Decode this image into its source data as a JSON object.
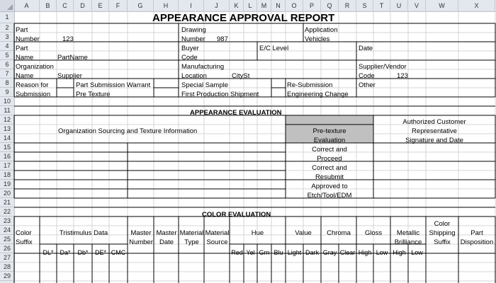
{
  "title": "APPEARANCE APPROVAL REPORT",
  "columns": [
    "A",
    "B",
    "C",
    "D",
    "E",
    "F",
    "G",
    "H",
    "I",
    "J",
    "K",
    "L",
    "M",
    "N",
    "O",
    "P",
    "Q",
    "R",
    "S",
    "T",
    "U",
    "V",
    "W",
    "X"
  ],
  "rows": [
    "1",
    "2",
    "3",
    "4",
    "5",
    "6",
    "7",
    "8",
    "9",
    "10",
    "11",
    "12",
    "13",
    "14",
    "15",
    "16",
    "17",
    "18",
    "19",
    "20",
    "21",
    "22",
    "23",
    "24",
    "25",
    "26",
    "27",
    "28",
    "29"
  ],
  "header": {
    "part_label": "Part",
    "part_number_label": "Number",
    "part_number": "123",
    "drawing_label": "Drawing",
    "drawing_number_label": "Number",
    "drawing_number": "987",
    "application_label": "Application",
    "vehicles_label": "Vehicles",
    "part_name_label1": "Part",
    "part_name_label2": "Name",
    "part_name": "PartName",
    "buyer_label": "Buyer",
    "buyer_code_label": "Code",
    "ec_level_label": "E/C Level",
    "date_label": "Date",
    "org_label": "Organization",
    "org_name_label": "Name",
    "org_name": "Supplier",
    "mfg_label": "Manufacturing",
    "mfg_location_label": "Location",
    "mfg_location": "CitySt",
    "supplier_label": "Supplier/Vendor",
    "supplier_code_label": "Code",
    "supplier_code": "123",
    "reason_label1": "Reason for",
    "reason_label2": "Submission",
    "psw": "Part Submission Warrant",
    "pre_texture": "Pre Texture",
    "special_sample": "Special Sample",
    "first_production": "First Production Shipment",
    "resubmission": "Re-Submission",
    "engineering_change": "Engineering Change",
    "other": "Other"
  },
  "appearance": {
    "section_title": "APPEARANCE EVALUATION",
    "sourcing_info": "Organization Sourcing and Texture Information",
    "pretexture_1": "Pre-texture",
    "pretexture_2": "Evaluation",
    "acr_1": "Authorized Customer",
    "acr_2": "Representative",
    "acr_3": "Signature and Date",
    "opt1_1": "Correct and",
    "opt1_2": "Proceed",
    "opt2_1": "Correct and",
    "opt2_2": "Resubmit",
    "opt3_1": "Approved to",
    "opt3_2": "Etch/Tool/EDM"
  },
  "color": {
    "section_title": "COLOR EVALUATION",
    "color_suffix_1": "Color",
    "color_suffix_2": "Suffix",
    "tristimulus": "Tristimulus Data",
    "master_number_1": "Master",
    "master_number_2": "Number",
    "master_date_1": "Master",
    "master_date_2": "Date",
    "material_type_1": "Material",
    "material_type_2": "Type",
    "material_source_1": "Material",
    "material_source_2": "Source",
    "hue": "Hue",
    "value": "Value",
    "chroma": "Chroma",
    "gloss": "Gloss",
    "metallic_1": "Metallic",
    "metallic_2": "Brilliance",
    "shipping_1": "Color",
    "shipping_2": "Shipping",
    "shipping_3": "Suffix",
    "part_disp_1": "Part",
    "part_disp_2": "Disposition",
    "sub_dl": "DL*",
    "sub_da": "Da*",
    "sub_db": "Db*",
    "sub_de": "DE*",
    "sub_cmc": "CMC",
    "sub_red": "Red",
    "sub_yel": "Yel",
    "sub_grn": "Grn",
    "sub_blu": "Blu",
    "sub_light": "Light",
    "sub_dark": "Dark",
    "sub_gray": "Gray",
    "sub_clear": "Clear",
    "sub_high": "High",
    "sub_low": "Low",
    "sub_high2": "High",
    "sub_low2": "Low"
  },
  "colors": {
    "header_bg": "#e3e7ee",
    "shaded_cell": "#c0c0c0",
    "gridline": "#d4d4d4"
  }
}
